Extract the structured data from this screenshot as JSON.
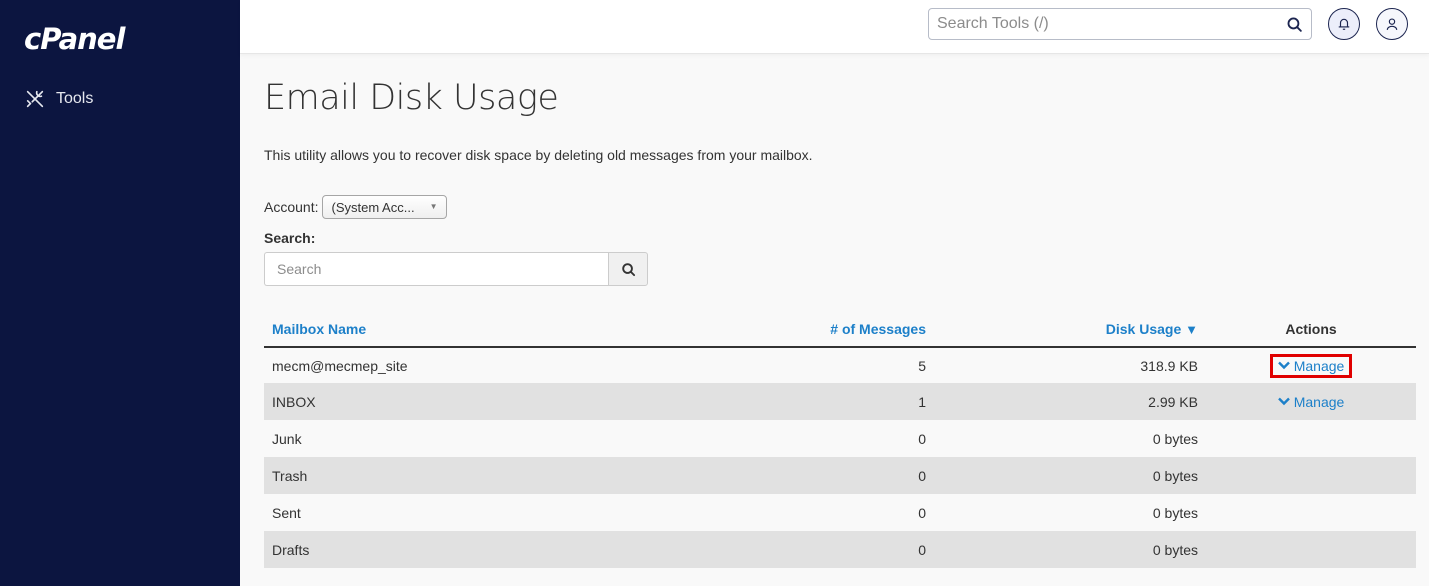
{
  "sidebar": {
    "logo": "cPanel",
    "items": [
      {
        "label": "Tools",
        "icon": "tools-icon"
      }
    ]
  },
  "topbar": {
    "search_placeholder": "Search Tools (/)",
    "notifications_icon": "bell-icon",
    "user_icon": "user-icon"
  },
  "page": {
    "title": "Email Disk Usage",
    "description": "This utility allows you to recover disk space by deleting old messages from your mailbox.",
    "account_label": "Account:",
    "account_selected": "(System Acc...",
    "search_label": "Search:",
    "search_placeholder": "Search"
  },
  "table": {
    "headers": {
      "mailbox": "Mailbox Name",
      "messages": "# of Messages",
      "disk_usage": "Disk Usage",
      "sort_indicator": "▼",
      "actions": "Actions"
    },
    "rows": [
      {
        "name": "mecm@mecmep_site",
        "messages": "5",
        "usage": "318.9 KB",
        "action": "Manage",
        "highlighted": true
      },
      {
        "name": "INBOX",
        "messages": "1",
        "usage": "2.99 KB",
        "action": "Manage"
      },
      {
        "name": "Junk",
        "messages": "0",
        "usage": "0 bytes",
        "action": ""
      },
      {
        "name": "Trash",
        "messages": "0",
        "usage": "0 bytes",
        "action": ""
      },
      {
        "name": "Sent",
        "messages": "0",
        "usage": "0 bytes",
        "action": ""
      },
      {
        "name": "Drafts",
        "messages": "0",
        "usage": "0 bytes",
        "action": ""
      }
    ]
  },
  "colors": {
    "sidebar_bg": "#0c1540",
    "link": "#1d80c9",
    "highlight_border": "#e00000",
    "row_alt": "#e1e1e1"
  }
}
